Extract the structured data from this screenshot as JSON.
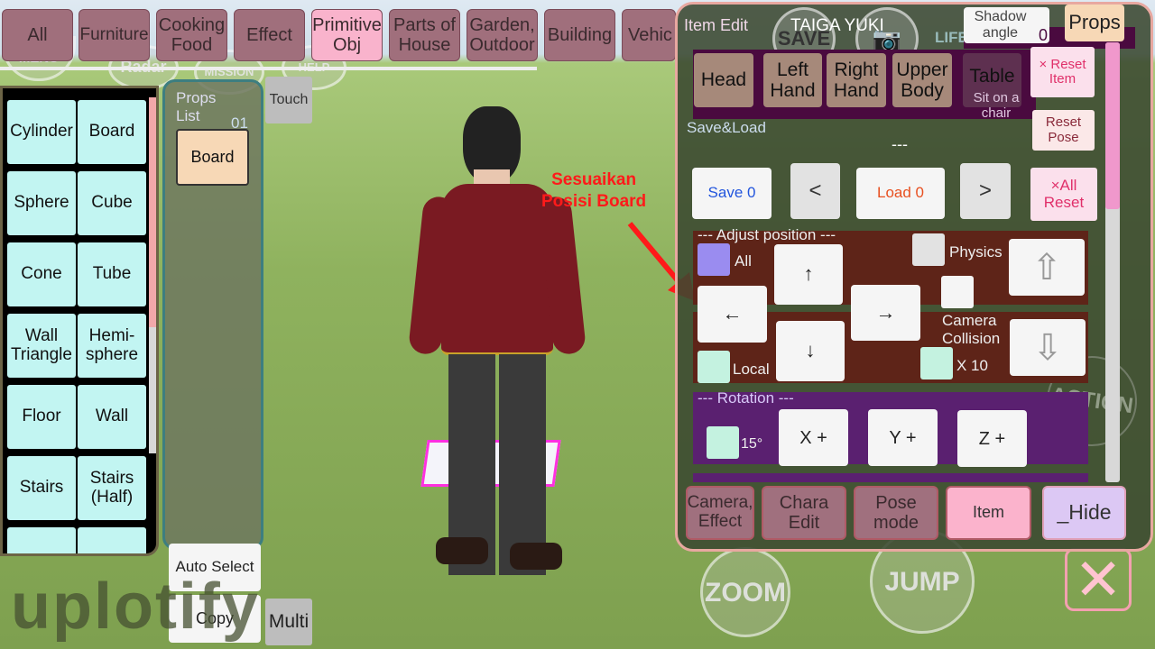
{
  "tabs": [
    "All",
    "Furniture",
    "Cooking Food",
    "Effect",
    "Primitive Obj",
    "Parts of House",
    "Garden, Outdoor",
    "Building",
    "Vehic"
  ],
  "active_tab": "Primitive Obj",
  "hud": {
    "menu": "MENU",
    "radar": "Radar",
    "mission": "MISSION",
    "help": "HELP",
    "zoom": "ZOOM",
    "jump": "JUMP",
    "action": "ACTION"
  },
  "props": [
    "Cylinder",
    "Board",
    "Sphere",
    "Cube",
    "Cone",
    "Tube",
    "Wall Triangle",
    "Hemi-sphere",
    "Floor",
    "Wall",
    "Stairs",
    "Stairs (Half)"
  ],
  "props_list": {
    "title": "Props List",
    "count": "01",
    "items": [
      "Board"
    ]
  },
  "touch": "Touch",
  "auto_select": "Auto Select",
  "copy": "Copy",
  "multi": "Multi",
  "annotation": {
    "line1": "Sesuaikan",
    "line2": "Posisi Board",
    "color": "#ff1a1a"
  },
  "watermark": "uplotify",
  "panel": {
    "title": "Item Edit",
    "character": "TAIGA YUKI",
    "save_icon": "SAVE",
    "life": "LIFE",
    "shadow_label": "Shadow angle",
    "shadow_value": "0",
    "props_btn": "Props",
    "attach": [
      "Head",
      "Left Hand",
      "Right Hand",
      "Upper Body",
      "Table"
    ],
    "table_sub": "Sit on a chair",
    "reset_item": "× Reset Item",
    "reset_pose": "Reset Pose",
    "save_load": "Save&Load",
    "slot_name": "---",
    "save": "Save 0",
    "prev": "<",
    "load": "Load 0",
    "next": ">",
    "all_reset": "×All Reset",
    "adjust_title": "--- Adjust position ---",
    "all": "All",
    "physics": "Physics",
    "camera_collision": "Camera Collision",
    "x10": "X 10",
    "local": "Local",
    "up": "↑",
    "down": "↓",
    "left": "←",
    "right": "→",
    "rotation_title": "--- Rotation ---",
    "deg": "15°",
    "xplus": "X +",
    "yplus": "Y +",
    "zplus": "Z +",
    "bottom": [
      "Camera, Effect",
      "Chara Edit",
      "Pose mode",
      "Item",
      "_Hide"
    ]
  }
}
